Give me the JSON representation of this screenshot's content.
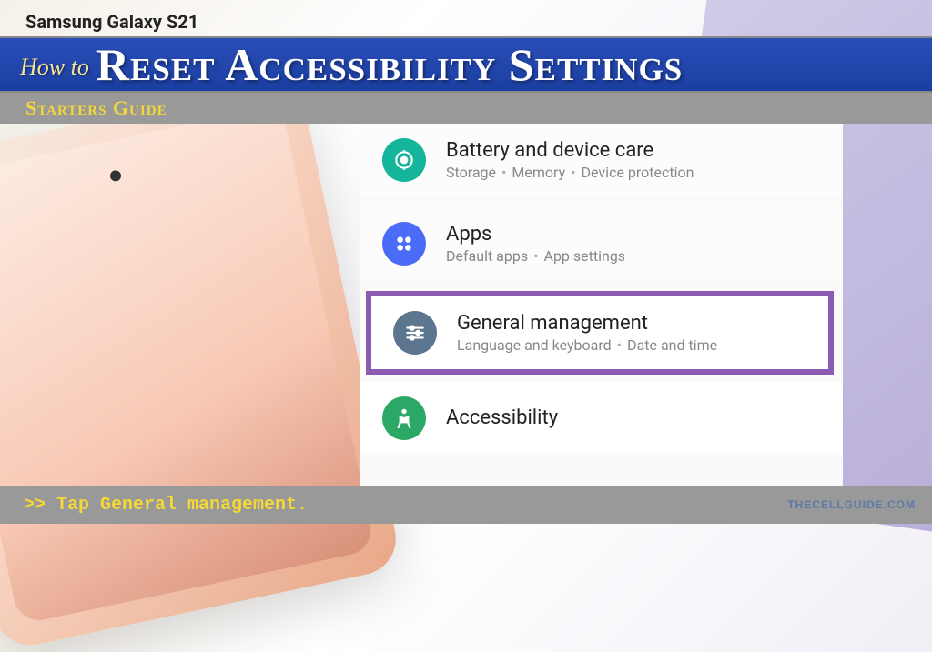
{
  "header": {
    "device": "Samsung Galaxy S21",
    "howto": "How to",
    "title": "Reset Accessibility Settings",
    "subtitle": "Starters Guide"
  },
  "settings": {
    "items": [
      {
        "title": "Battery and device care",
        "sub_parts": [
          "Storage",
          "Memory",
          "Device protection"
        ]
      },
      {
        "title": "Apps",
        "sub_parts": [
          "Default apps",
          "App settings"
        ]
      },
      {
        "title": "General management",
        "sub_parts": [
          "Language and keyboard",
          "Date and time"
        ]
      },
      {
        "title": "Accessibility",
        "sub_parts": []
      }
    ]
  },
  "footer": {
    "instruction": ">> Tap General management.",
    "watermark": "THECELLGUIDE.COM"
  }
}
